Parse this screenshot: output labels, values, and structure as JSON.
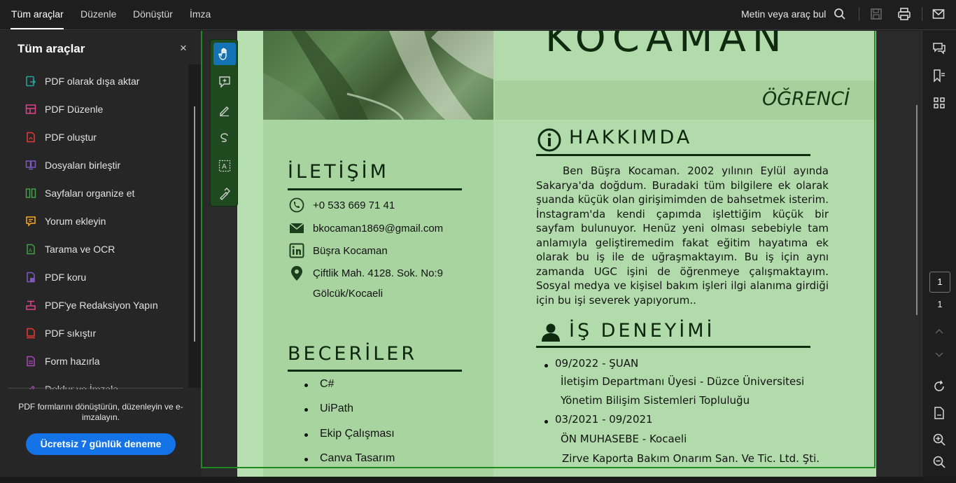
{
  "topbar": {
    "menu": [
      "Tüm araçlar",
      "Düzenle",
      "Dönüştür",
      "İmza"
    ],
    "search_label": "Metin veya araç bul",
    "icons": [
      "search-icon",
      "save-icon",
      "print-icon",
      "mail-icon"
    ]
  },
  "left_panel": {
    "title": "Tüm araçlar",
    "close": "×",
    "tools": [
      {
        "label": "PDF olarak dışa aktar",
        "icon": "export-pdf-icon",
        "color": "#26a69a"
      },
      {
        "label": "PDF Düzenle",
        "icon": "edit-pdf-icon",
        "color": "#e0448c"
      },
      {
        "label": "PDF oluştur",
        "icon": "create-pdf-icon",
        "color": "#e53935"
      },
      {
        "label": "Dosyaları birleştir",
        "icon": "combine-files-icon",
        "color": "#7e57c2"
      },
      {
        "label": "Sayfaları organize et",
        "icon": "organize-pages-icon",
        "color": "#43a047"
      },
      {
        "label": "Yorum ekleyin",
        "icon": "comment-icon",
        "color": "#f9a825"
      },
      {
        "label": "Tarama ve OCR",
        "icon": "scan-ocr-icon",
        "color": "#43a047"
      },
      {
        "label": "PDF koru",
        "icon": "protect-pdf-icon",
        "color": "#7e57c2"
      },
      {
        "label": "PDF'ye Redaksiyon Yapın",
        "icon": "redact-icon",
        "color": "#e0448c"
      },
      {
        "label": "PDF sıkıştır",
        "icon": "compress-pdf-icon",
        "color": "#e53935"
      },
      {
        "label": "Form hazırla",
        "icon": "prepare-form-icon",
        "color": "#ab47bc"
      },
      {
        "label": "Doldur ve İmzala",
        "icon": "fill-sign-icon",
        "color": "#ab47bc"
      }
    ],
    "promo_text": "PDF formlarını dönüştürün, düzenleyin ve e-imzalayın.",
    "trial_button": "Ücretsiz 7 günlük deneme"
  },
  "floating_toolbar": {
    "tools": [
      "hand-icon",
      "add-comment-icon",
      "highlight-icon",
      "freehand-icon",
      "text-select-icon",
      "sign-icon"
    ]
  },
  "document": {
    "name_partial": "KOCAMAN",
    "role": "ÖĞRENCİ",
    "sections": {
      "contact_title": "İLETİŞİM",
      "skills_title": "BECERİLER",
      "about_title": "HAKKIMDA",
      "experience_title": "İŞ DENEYİMİ"
    },
    "contact": {
      "phone": "+0 533 669 71 41",
      "email": "bkocaman1869@gmail.com",
      "linkedin": "Büşra Kocaman",
      "address_line1": "Çiftlik Mah. 4128. Sok. No:9",
      "address_line2": "Gölcük/Kocaeli"
    },
    "skills": [
      "C#",
      "UiPath",
      "Ekip Çalışması",
      "Canva Tasarım"
    ],
    "about": "Ben Büşra Kocaman. 2002 yılının Eylül ayında Sakarya'da doğdum. Buradaki tüm bilgilere ek olarak şuanda küçük olan girişimimden de bahsetmek isterim. İnstagram'da kendi çapımda işlettiğim küçük bir sayfam bulunuyor. Henüz yeni olması sebebiyle tam anlamıyla geliştiremedim fakat eğitim hayatıma ek olarak bu iş ile de uğraşmaktayım. Bu iş için aynı zamanda UGC işini de öğrenmeye çalışmaktayım. Sosyal medya ve kişisel bakım işleri ilgi alanıma girdiği için bu işi severek yapıyorum..",
    "experience": [
      {
        "date": "09/2022 - ŞUAN",
        "line1": "İletişim Departmanı Üyesi - Düzce Üniversitesi",
        "line2": "Yönetim Bilişim Sistemleri Topluluğu"
      },
      {
        "date": "03/2021 - 09/2021",
        "line1": "ÖN MUHASEBE  -  Kocaeli",
        "line2": "Zirve Kaporta Bakım Onarım San. Ve Tic. Ltd. Şti."
      }
    ]
  },
  "right_rail": {
    "icons": [
      "comment-panel-icon",
      "bookmark-icon",
      "thumbnails-icon",
      "refresh-icon",
      "page-info-icon",
      "zoom-in-icon",
      "zoom-out-icon"
    ],
    "current_page": "1",
    "total_pages": "1"
  }
}
